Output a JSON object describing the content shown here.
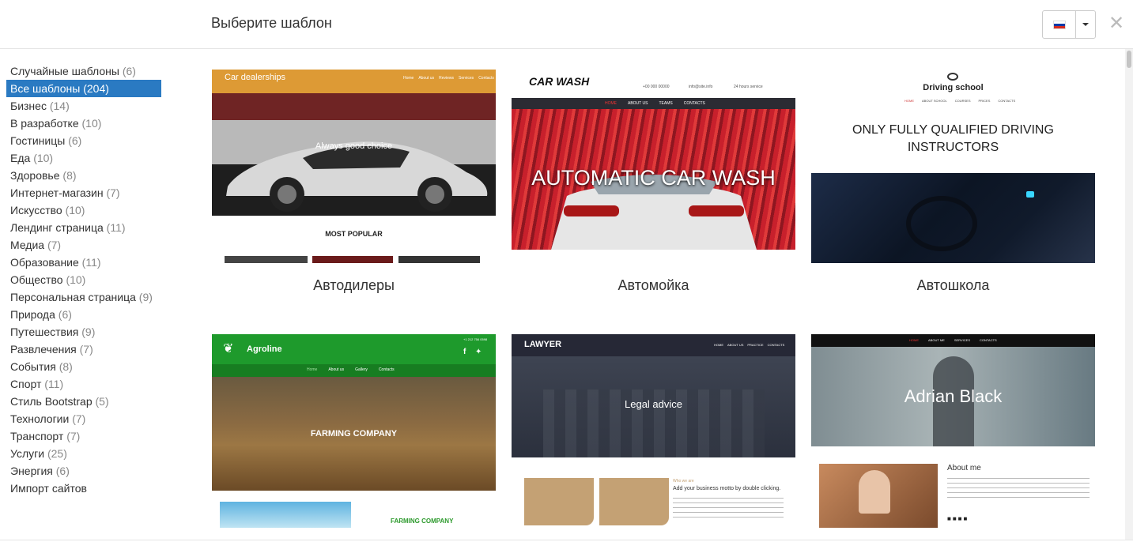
{
  "header": {
    "title": "Выберите шаблон",
    "language_flag": "flag-ru-icon",
    "close_glyph": "✕"
  },
  "sidebar": {
    "categories": [
      {
        "name": "Случайные шаблоны",
        "count": "(6)"
      },
      {
        "name": "Все шаблоны (204)",
        "count": "",
        "active": true
      },
      {
        "name": "Бизнес",
        "count": "(14)"
      },
      {
        "name": "В разработке",
        "count": "(10)"
      },
      {
        "name": "Гостиницы",
        "count": "(6)"
      },
      {
        "name": "Еда",
        "count": "(10)"
      },
      {
        "name": "Здоровье",
        "count": "(8)"
      },
      {
        "name": "Интернет-магазин",
        "count": "(7)"
      },
      {
        "name": "Искусство",
        "count": "(10)"
      },
      {
        "name": "Лендинг страница",
        "count": "(11)"
      },
      {
        "name": "Медиа",
        "count": "(7)"
      },
      {
        "name": "Образование",
        "count": "(11)"
      },
      {
        "name": "Общество",
        "count": "(10)"
      },
      {
        "name": "Персональная страница",
        "count": "(9)"
      },
      {
        "name": "Природа",
        "count": "(6)"
      },
      {
        "name": "Путешествия",
        "count": "(9)"
      },
      {
        "name": "Развлечения",
        "count": "(7)"
      },
      {
        "name": "События",
        "count": "(8)"
      },
      {
        "name": "Спорт",
        "count": "(11)"
      },
      {
        "name": "Стиль Bootstrap",
        "count": "(5)"
      },
      {
        "name": "Технологии",
        "count": "(7)"
      },
      {
        "name": "Транспорт",
        "count": "(7)"
      },
      {
        "name": "Услуги",
        "count": "(25)"
      },
      {
        "name": "Энергия",
        "count": "(6)"
      },
      {
        "name": "Импорт сайтов",
        "count": ""
      }
    ]
  },
  "templates": [
    {
      "label": "Автодилеры",
      "preview": {
        "brand": "Car dealerships",
        "nav": [
          "Home",
          "About us",
          "Reviews",
          "Services",
          "Contacts"
        ],
        "hero": "Always good choice",
        "section": "MOST POPULAR"
      }
    },
    {
      "label": "Автомойка",
      "preview": {
        "brand": "CAR WASH",
        "contacts": [
          "+00 000 00000",
          "info@site.info",
          "24 hours service"
        ],
        "nav": [
          "HOME",
          "ABOUT US",
          "TEAMS",
          "CONTACTS"
        ],
        "hero": "AUTOMATIC CAR WASH"
      }
    },
    {
      "label": "Автошкола",
      "preview": {
        "brand": "Driving school",
        "nav": [
          "HOME",
          "ABOUT SCHOOL",
          "COURSES",
          "PRICES",
          "CONTACTS"
        ],
        "hero": "ONLY FULLY QUALIFIED DRIVING INSTRUCTORS"
      }
    },
    {
      "label": "",
      "preview": {
        "brand": "Agroline",
        "phone": "+1 212 756 0598",
        "nav": [
          "Home",
          "About us",
          "Gallery",
          "Contacts"
        ],
        "hero": "FARMING COMPANY",
        "footer_text": "FARMING COMPANY"
      }
    },
    {
      "label": "",
      "preview": {
        "brand": "LAWYER",
        "nav": [
          "HOME",
          "ABOUT US",
          "PRACTICE",
          "CONTACTS"
        ],
        "hero": "Legal advice",
        "kicker": "Who we are",
        "motto": "Add your business motto by double clicking."
      }
    },
    {
      "label": "",
      "preview": {
        "nav": [
          "HOME",
          "ABOUT ME",
          "SERVICES",
          "CONTACTS"
        ],
        "hero": "Adrian Black",
        "about_title": "About me"
      }
    }
  ]
}
